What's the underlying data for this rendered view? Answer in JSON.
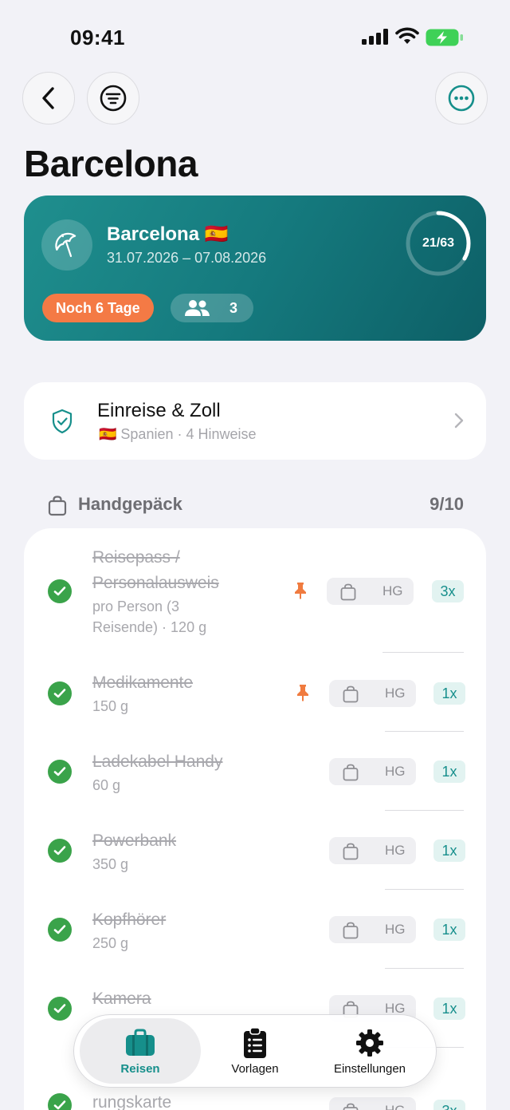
{
  "status_bar": {
    "time": "09:41"
  },
  "header": {
    "title": "Barcelona"
  },
  "trip_card": {
    "name": "Barcelona 🇪🇸",
    "dates": "31.07.2026 – 07.08.2026",
    "progress_label": "21/63",
    "progress_fraction": 0.333,
    "countdown": "Noch 6 Tage",
    "travelers": "3",
    "colors": {
      "card": "#157a7e",
      "countdown_pill": "#f47a45"
    }
  },
  "customs": {
    "title": "Einreise & Zoll",
    "subtitle": "🇪🇸 Spanien · 4 Hinweise"
  },
  "section": {
    "title": "Handgepäck",
    "count": "9/10"
  },
  "items": [
    {
      "name_line1": "Reisepass /",
      "name_line2": "Personalausweis",
      "detail_line1": "pro Person (3",
      "detail_line2": "Reisende) · 120 g",
      "pinned": true,
      "bag": "HG",
      "qty": "3x"
    },
    {
      "name": "Medikamente",
      "detail": "150 g",
      "pinned": true,
      "bag": "HG",
      "qty": "1x"
    },
    {
      "name": "Ladekabel Handy",
      "detail": "60 g",
      "pinned": false,
      "bag": "HG",
      "qty": "1x"
    },
    {
      "name": "Powerbank",
      "detail": "350 g",
      "pinned": false,
      "bag": "HG",
      "qty": "1x"
    },
    {
      "name": "Kopfhörer",
      "detail": "250 g",
      "pinned": false,
      "bag": "HG",
      "qty": "1x"
    },
    {
      "name": "Kamera",
      "detail": "",
      "pinned": false,
      "bag": "HG",
      "qty": "1x"
    },
    {
      "name": "rungskarte",
      "detail": "",
      "pinned": false,
      "bag": "HG",
      "qty": "3x"
    }
  ],
  "tabbar": {
    "tabs": [
      {
        "label": "Reisen",
        "icon": "suitcase-icon",
        "active": true
      },
      {
        "label": "Vorlagen",
        "icon": "clipboard-list-icon",
        "active": false
      },
      {
        "label": "Einstellungen",
        "icon": "gear-icon",
        "active": false
      }
    ],
    "accent": "#168f8b"
  }
}
